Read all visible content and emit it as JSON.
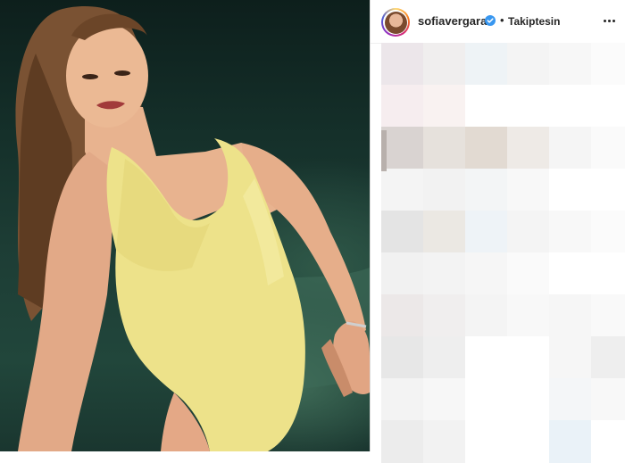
{
  "post": {
    "image_icon": "portrait-photo"
  },
  "header": {
    "username": "sofiavergara",
    "verified_icon": "verified-badge-icon",
    "separator": "•",
    "follow_status": "Takiptesin",
    "more_icon": "more-options-icon"
  },
  "comments": {
    "censored": true,
    "icon": "pixelated-mosaic"
  },
  "colors": {
    "verified_blue": "#3897f0",
    "text": "#262626",
    "swimsuit": "#ede28a"
  }
}
